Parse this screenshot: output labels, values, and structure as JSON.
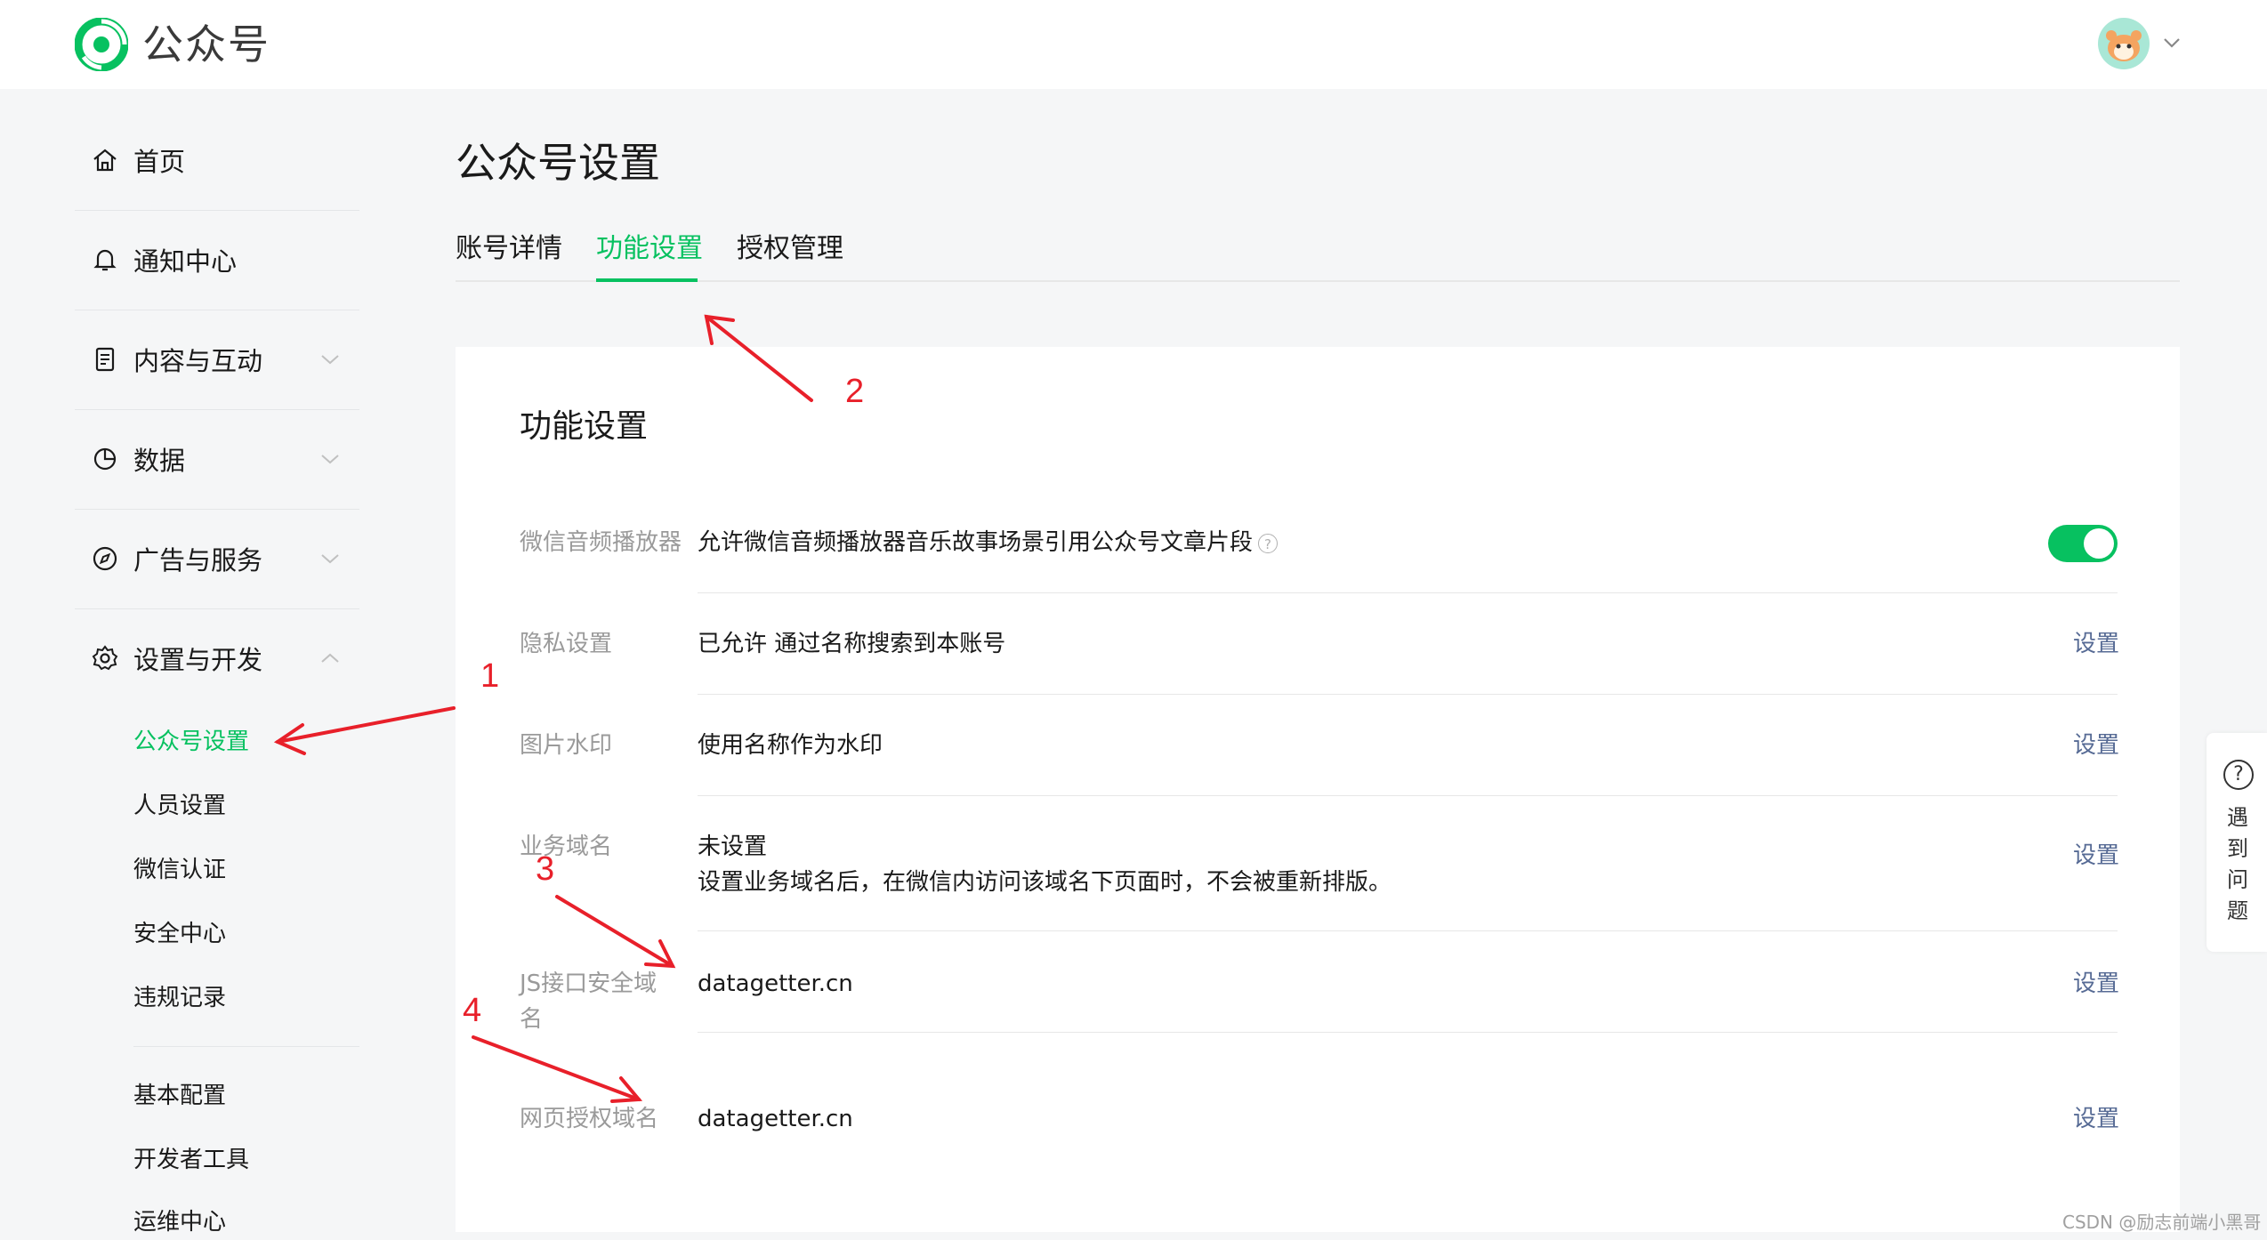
{
  "header": {
    "brand": "公众号",
    "avatar_icon": "hamster-avatar",
    "accent": "#07c160"
  },
  "sidebar": {
    "items": [
      {
        "label": "首页",
        "icon": "home-icon"
      },
      {
        "label": "通知中心",
        "icon": "bell-icon"
      },
      {
        "label": "内容与互动",
        "icon": "document-icon"
      },
      {
        "label": "数据",
        "icon": "pie-icon"
      },
      {
        "label": "广告与服务",
        "icon": "compass-icon"
      },
      {
        "label": "设置与开发",
        "icon": "gear-icon"
      }
    ],
    "sub_items": [
      "公众号设置",
      "人员设置",
      "微信认证",
      "安全中心",
      "违规记录"
    ],
    "dev_items": [
      "基本配置",
      "开发者工具",
      "运维中心"
    ]
  },
  "main": {
    "title": "公众号设置",
    "tabs": [
      "账号详情",
      "功能设置",
      "授权管理"
    ],
    "active_tab": "功能设置",
    "card": {
      "title": "功能设置",
      "rows": [
        {
          "label": "微信音频播放器",
          "value": "允许微信音频播放器音乐故事场景引用公众号文章片段",
          "toggle_on": true
        },
        {
          "label": "隐私设置",
          "value": "已允许 通过名称搜索到本账号",
          "action": "设置"
        },
        {
          "label": "图片水印",
          "value": "使用名称作为水印",
          "action": "设置"
        },
        {
          "label": "业务域名",
          "value": "未设置",
          "sub_value": "设置业务域名后，在微信内访问该域名下页面时，不会被重新排版。",
          "action": "设置"
        },
        {
          "label": "JS接口安全域名",
          "value": "datagetter.cn",
          "action": "设置"
        },
        {
          "label": "网页授权域名",
          "value": "datagetter.cn",
          "action": "设置"
        }
      ]
    }
  },
  "help_float": {
    "icon": "question-icon",
    "text": "遇到问题"
  },
  "annotations": [
    "1",
    "2",
    "3",
    "4"
  ],
  "watermark": "CSDN @励志前端小黑哥"
}
